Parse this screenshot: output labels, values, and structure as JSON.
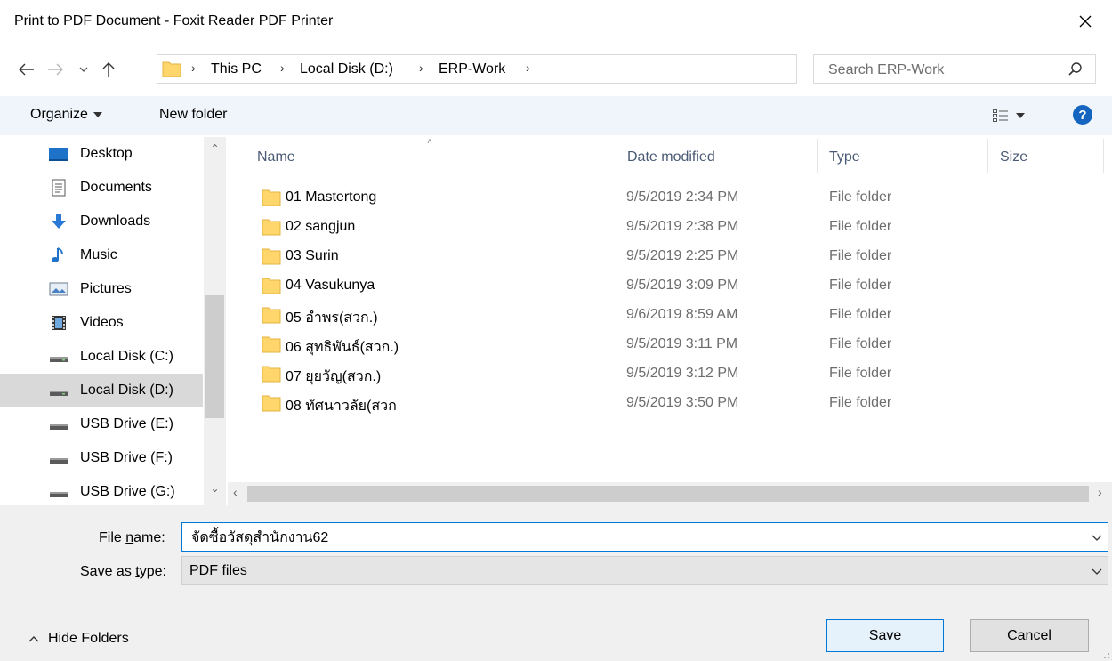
{
  "window": {
    "title": "Print to PDF Document - Foxit Reader PDF Printer"
  },
  "address": {
    "crumbs": [
      "This PC",
      "Local Disk (D:)",
      "ERP-Work"
    ]
  },
  "search": {
    "placeholder": "Search ERP-Work"
  },
  "toolbar": {
    "organize_label": "Organize",
    "new_folder_label": "New folder"
  },
  "nav": {
    "items": [
      {
        "label": "Desktop",
        "icon": "desktop-icon"
      },
      {
        "label": "Documents",
        "icon": "documents-icon"
      },
      {
        "label": "Downloads",
        "icon": "downloads-icon"
      },
      {
        "label": "Music",
        "icon": "music-icon"
      },
      {
        "label": "Pictures",
        "icon": "pictures-icon"
      },
      {
        "label": "Videos",
        "icon": "videos-icon"
      },
      {
        "label": "Local Disk (C:)",
        "icon": "drive-icon"
      },
      {
        "label": "Local Disk (D:)",
        "icon": "drive-icon",
        "selected": true
      },
      {
        "label": "USB Drive (E:)",
        "icon": "drive-icon"
      },
      {
        "label": "USB Drive (F:)",
        "icon": "drive-icon"
      },
      {
        "label": "USB Drive (G:)",
        "icon": "drive-icon"
      }
    ]
  },
  "columns": {
    "name": "Name",
    "date": "Date modified",
    "type": "Type",
    "size": "Size"
  },
  "files": [
    {
      "name": "01 Mastertong",
      "date": "9/5/2019 2:34 PM",
      "type": "File folder"
    },
    {
      "name": "02 sangjun",
      "date": "9/5/2019 2:38 PM",
      "type": "File folder"
    },
    {
      "name": "03 Surin",
      "date": "9/5/2019 2:25 PM",
      "type": "File folder"
    },
    {
      "name": "04 Vasukunya",
      "date": "9/5/2019 3:09 PM",
      "type": "File folder"
    },
    {
      "name": "05 อำพร(สวก.)",
      "date": "9/6/2019 8:59 AM",
      "type": "File folder"
    },
    {
      "name": "06 สุทธิพันธ์(สวก.)",
      "date": "9/5/2019 3:11 PM",
      "type": "File folder"
    },
    {
      "name": "07 ยุยวัญ(สวก.)",
      "date": "9/5/2019 3:12 PM",
      "type": "File folder"
    },
    {
      "name": "08 ทัศนาวลัย(สวก",
      "date": "9/5/2019 3:50 PM",
      "type": "File folder"
    }
  ],
  "form": {
    "file_name_label_pre": "File ",
    "file_name_label_u": "n",
    "file_name_label_post": "ame:",
    "file_name_value": "จัดซื้อวัสดุสำนักงาน62",
    "save_type_label_pre": "Save as ",
    "save_type_label_u": "t",
    "save_type_label_post": "ype:",
    "save_type_value": "PDF files"
  },
  "footer": {
    "hide_folders_label": "Hide Folders",
    "save_label_u": "S",
    "save_label_rest": "ave",
    "cancel_label": "Cancel"
  },
  "colors": {
    "accent": "#0078d7",
    "folder": "#ffd66b",
    "help": "#1565c0"
  }
}
